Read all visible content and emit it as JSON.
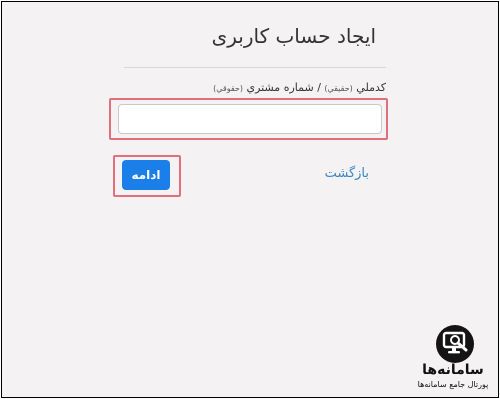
{
  "form": {
    "title": "ایجاد حساب کاربری",
    "field_label_main": "کدملي",
    "field_label_note1": "(حقيقي)",
    "field_label_sep": " / شماره مشتري ",
    "field_label_note2": "(حقوقي)",
    "input_value": "",
    "input_placeholder": ""
  },
  "actions": {
    "continue_label": "ادامه",
    "back_label": "بازگشت"
  },
  "watermark": {
    "name": "سامانه‌ها",
    "tagline": "پورتال جامع سامانه‌ها"
  },
  "colors": {
    "primary": "#1a7fe8",
    "link": "#3a86c8",
    "highlight": "#e0707a",
    "background": "#f4f2f2"
  }
}
